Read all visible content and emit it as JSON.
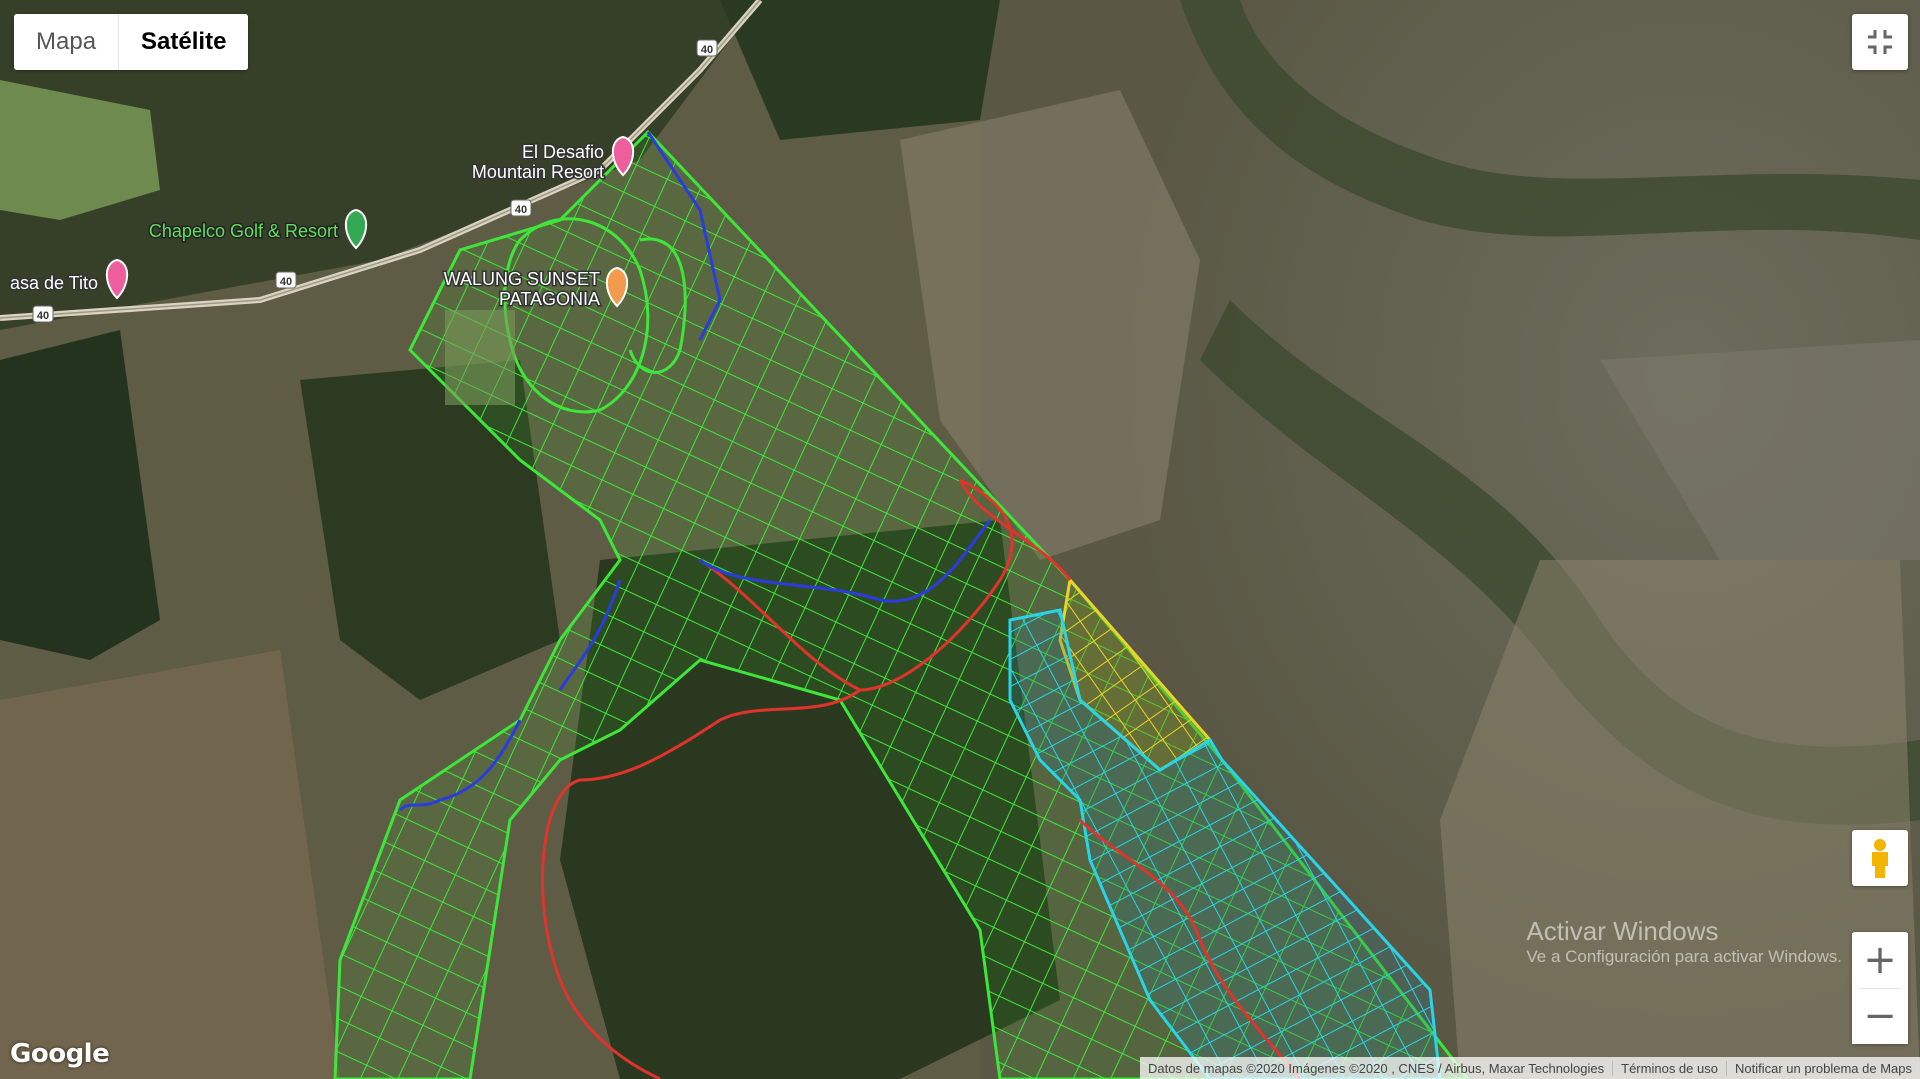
{
  "map_type": {
    "options": [
      "Mapa",
      "Satélite"
    ],
    "selected": "Satélite"
  },
  "controls": {
    "fullscreen_icon": "fullscreen-exit-icon",
    "pegman_icon": "pegman-icon",
    "zoom_in": "+",
    "zoom_out": "−"
  },
  "places": {
    "resort": {
      "line1": "El Desafio",
      "line2": "Mountain Resort",
      "color": "#ee5d9c"
    },
    "golf": {
      "name": "Chapelco Golf & Resort",
      "color": "#34a853"
    },
    "tito": {
      "name": "asa de Tito",
      "color": "#ee5d9c"
    },
    "walung": {
      "line1": "WALUNG SUNSET",
      "line2": "PATAGONIA",
      "color": "#f29b4d"
    }
  },
  "road": {
    "route": "40"
  },
  "overlay_colors": {
    "green": "#3ee63a",
    "cyan": "#29d4e6",
    "yellow": "#e6d52a",
    "red": "#e0332c",
    "blue": "#2a3cdc"
  },
  "branding": {
    "logo": "Google"
  },
  "attribution": {
    "data": "Datos de mapas ©2020 Imágenes ©2020 , CNES / Airbus, Maxar Technologies",
    "terms": "Términos de uso",
    "report": "Notificar un problema de Maps"
  },
  "watermark": {
    "line1": "Activar Windows",
    "line2": "Ve a Configuración para activar Windows."
  }
}
